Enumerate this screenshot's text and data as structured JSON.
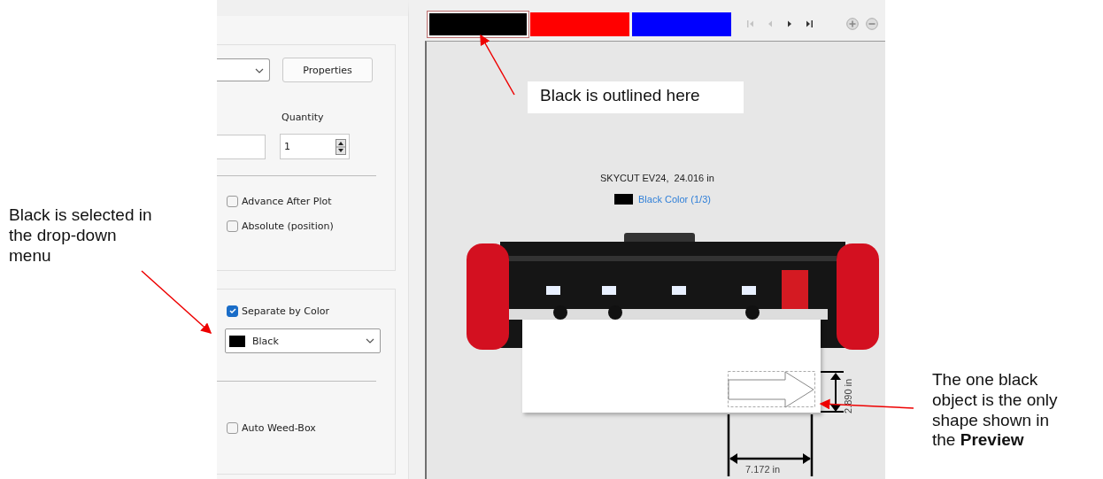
{
  "settings_panel": {
    "properties_button": "Properties",
    "quantity": {
      "label": "Quantity",
      "value": "1"
    },
    "options": [
      {
        "label": "Advance After Plot",
        "checked": false
      },
      {
        "label": "Absolute (position)",
        "checked": false
      }
    ],
    "separate_by_color": {
      "label": "Separate by Color",
      "checked": true
    },
    "color_dropdown": {
      "value": "Black",
      "color": "#000000"
    },
    "auto_weed_box": {
      "label": "Auto Weed-Box",
      "checked": false
    }
  },
  "preview": {
    "color_tabs": [
      {
        "color": "#000000",
        "selected": true
      },
      {
        "color": "#ff0000",
        "selected": false
      },
      {
        "color": "#0000ff",
        "selected": false
      }
    ],
    "nav_buttons": [
      {
        "kind": "first",
        "disabled": true
      },
      {
        "kind": "prev",
        "disabled": true
      },
      {
        "kind": "next",
        "disabled": false
      },
      {
        "kind": "last",
        "disabled": false
      }
    ],
    "zoom_buttons": [
      {
        "kind": "zoom-in"
      },
      {
        "kind": "zoom-out"
      }
    ],
    "machine": "SKYCUT EV24,  24.016 in",
    "current_color": {
      "label": "Black Color (1/3)",
      "color": "#000000"
    },
    "height_dimension": "2.890 in",
    "width_dimension": "7.172 in"
  },
  "annotations": [
    {
      "kind": "top",
      "text": "Black is outlined here"
    },
    {
      "kind": "left",
      "text": "Black is selected in the drop-down menu"
    },
    {
      "kind": "right",
      "text": "The one black object is the only shape shown in the **Preview**"
    }
  ]
}
